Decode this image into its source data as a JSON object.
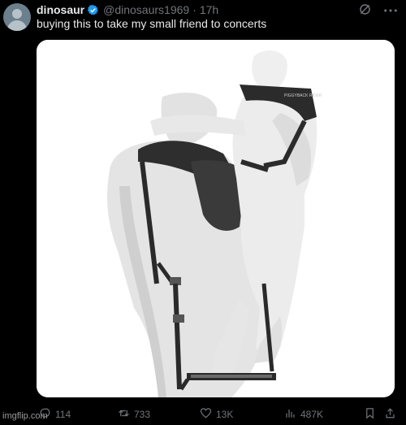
{
  "author": {
    "name": "dinosaur",
    "handle": "@dinosaurs1969",
    "separator": "·",
    "time": "17h",
    "verified": true
  },
  "tweet": {
    "text": "buying this to take my small friend to concerts",
    "media_label": "PIGGYBACK RIDER"
  },
  "actions": {
    "replies": "114",
    "retweets": "733",
    "likes": "13K",
    "views": "487K"
  },
  "watermark": "imgflip.com",
  "colors": {
    "background": "#000000",
    "text": "#e7e9ea",
    "muted": "#71767b",
    "verified": "#1d9bf0"
  }
}
